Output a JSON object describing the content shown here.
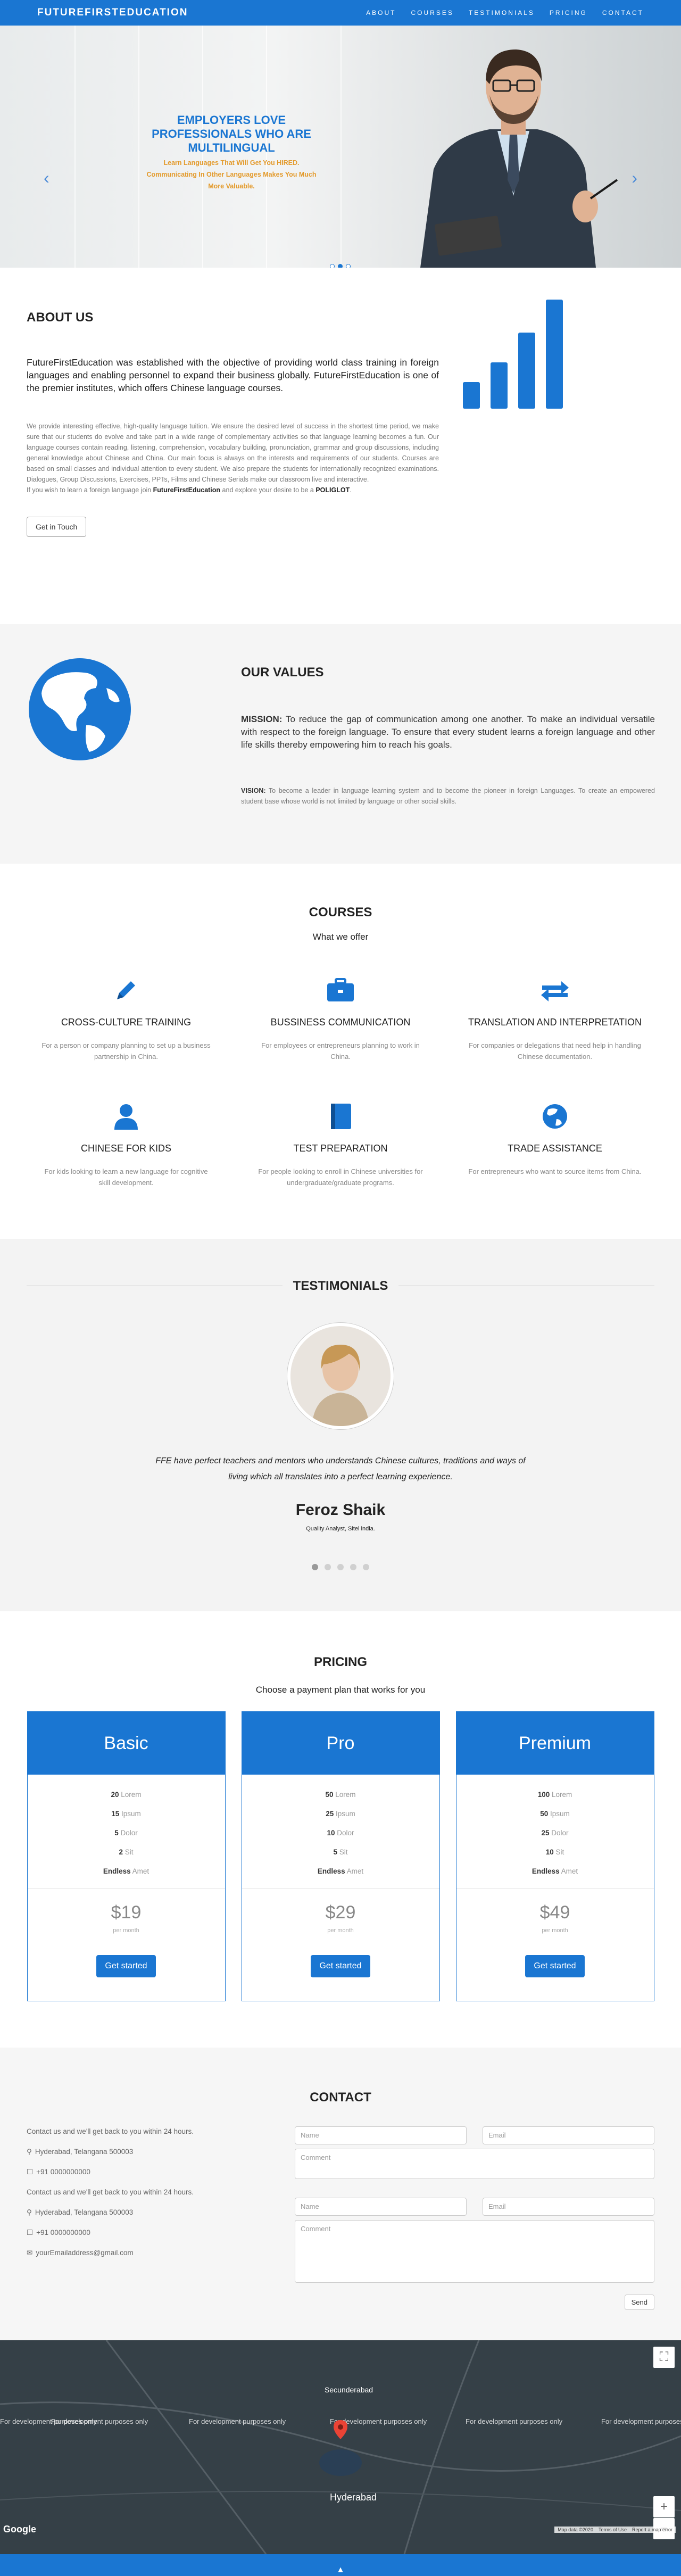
{
  "brand": "FUTUREFIRSTEDUCATION",
  "nav": [
    "ABOUT",
    "COURSES",
    "TESTIMONIALS",
    "PRICING",
    "CONTACT"
  ],
  "hero": {
    "title": "EMPLOYERS LOVE PROFESSIONALS WHO ARE MULTILINGUAL",
    "subtitle": "Learn Languages That Will Get You HIRED. Communicating In Other Languages Makes You Much More Valuable.",
    "prev": "‹",
    "next": "›"
  },
  "about": {
    "heading": "ABOUT US",
    "lead": "FutureFirstEducation was established with the objective of providing world class training in foreign languages and enabling personnel to expand their business globally. FutureFirstEducation is one of the premier institutes, which offers Chinese language courses.",
    "body": "We provide interesting effective, high-quality language tuition. We ensure the desired level of success in the shortest time period, we make sure that our students do evolve and take part in a wide range of complementary activities so that language learning becomes a fun. Our language courses contain reading, listening, comprehension, vocabulary building, pronunciation, grammar and group discussions, including general knowledge about Chinese and China. Our main focus is always on the interests and requirements of our students. Courses are based on small classes and individual attention to every student. We also prepare the students for internationally recognized examinations. Dialogues, Group Discussions, Exercises, PPTs, Films and Chinese Serials make our classroom live and interactive.",
    "cta_pre": "If you wish to learn a foreign language join ",
    "cta_brand": "FutureFirstEducation",
    "cta_mid": " and explore your desire to be a ",
    "cta_poly": "POLIGLOT",
    "cta_end": ".",
    "button": "Get in Touch"
  },
  "values": {
    "heading": "OUR VALUES",
    "mission_label": "MISSION:",
    "mission": " To reduce the gap of communication among one another. To make an individual versatile with respect to the foreign language. To ensure that every student learns a foreign language and other life skills thereby empowering him to reach his goals.",
    "vision_label": "VISION:",
    "vision": " To become a leader in language learning system and to become the pioneer in foreign Languages. To create an empowered student base whose world is not limited by language or other social skills."
  },
  "courses": {
    "heading": "COURSES",
    "sub": "What we offer",
    "items": [
      {
        "icon": "pencil-icon",
        "title": "CROSS-CULTURE TRAINING",
        "desc": "For a person or company planning to set up a business partnership in China."
      },
      {
        "icon": "briefcase-icon",
        "title": "BUSSINESS COMMUNICATION",
        "desc": "For employees or entrepreneurs planning to work in China."
      },
      {
        "icon": "exchange-icon",
        "title": "TRANSLATION AND INTERPRETATION",
        "desc": "For companies or delegations that need help in handling Chinese documentation."
      },
      {
        "icon": "user-icon",
        "title": "CHINESE FOR KIDS",
        "desc": "For kids looking to learn a new language for cognitive skill development."
      },
      {
        "icon": "book-icon",
        "title": "TEST PREPARATION",
        "desc": "For people looking to enroll in Chinese universities for undergraduate/graduate programs."
      },
      {
        "icon": "globe-icon",
        "title": "TRADE ASSISTANCE",
        "desc": "For entrepreneurs who want to source items from China."
      }
    ]
  },
  "testimonials": {
    "heading": "TESTIMONIALS",
    "quote": "FFE have perfect teachers and mentors who understands Chinese cultures, traditions and ways of living which all translates into a perfect learning experience.",
    "name": "Feroz Shaik",
    "role": "Quality Analyst, Sitel india."
  },
  "pricing": {
    "heading": "PRICING",
    "sub": "Choose a payment plan that works for you",
    "plans": [
      {
        "name": "Basic",
        "feats": [
          [
            "20",
            "Lorem"
          ],
          [
            "15",
            "Ipsum"
          ],
          [
            "5",
            "Dolor"
          ],
          [
            "2",
            "Sit"
          ],
          [
            "Endless",
            "Amet"
          ]
        ],
        "price": "$19",
        "per": "per month",
        "btn": "Get started"
      },
      {
        "name": "Pro",
        "feats": [
          [
            "50",
            "Lorem"
          ],
          [
            "25",
            "Ipsum"
          ],
          [
            "10",
            "Dolor"
          ],
          [
            "5",
            "Sit"
          ],
          [
            "Endless",
            "Amet"
          ]
        ],
        "price": "$29",
        "per": "per month",
        "btn": "Get started"
      },
      {
        "name": "Premium",
        "feats": [
          [
            "100",
            "Lorem"
          ],
          [
            "50",
            "Ipsum"
          ],
          [
            "25",
            "Dolor"
          ],
          [
            "10",
            "Sit"
          ],
          [
            "Endless",
            "Amet"
          ]
        ],
        "price": "$49",
        "per": "per month",
        "btn": "Get started"
      }
    ]
  },
  "contact": {
    "heading": "CONTACT",
    "intro": "Contact us and we'll get back to you within 24 hours.",
    "address": "Hyderabad, Telangana 500003",
    "phone": "+91 0000000000",
    "email": "yourEmailaddress@gmail.com",
    "name_ph": "Name",
    "email_ph": "Email",
    "comment_ph": "Comment",
    "send": "Send"
  },
  "map": {
    "warning": "For development purposes only",
    "city1": "Secunderabad",
    "city2": "Hyderabad",
    "google": "Google",
    "footer": [
      "Map data ©2020",
      "Terms of Use",
      "Report a map error"
    ]
  },
  "colors": {
    "primary": "#1a76d2",
    "accent": "#e39a2b"
  }
}
